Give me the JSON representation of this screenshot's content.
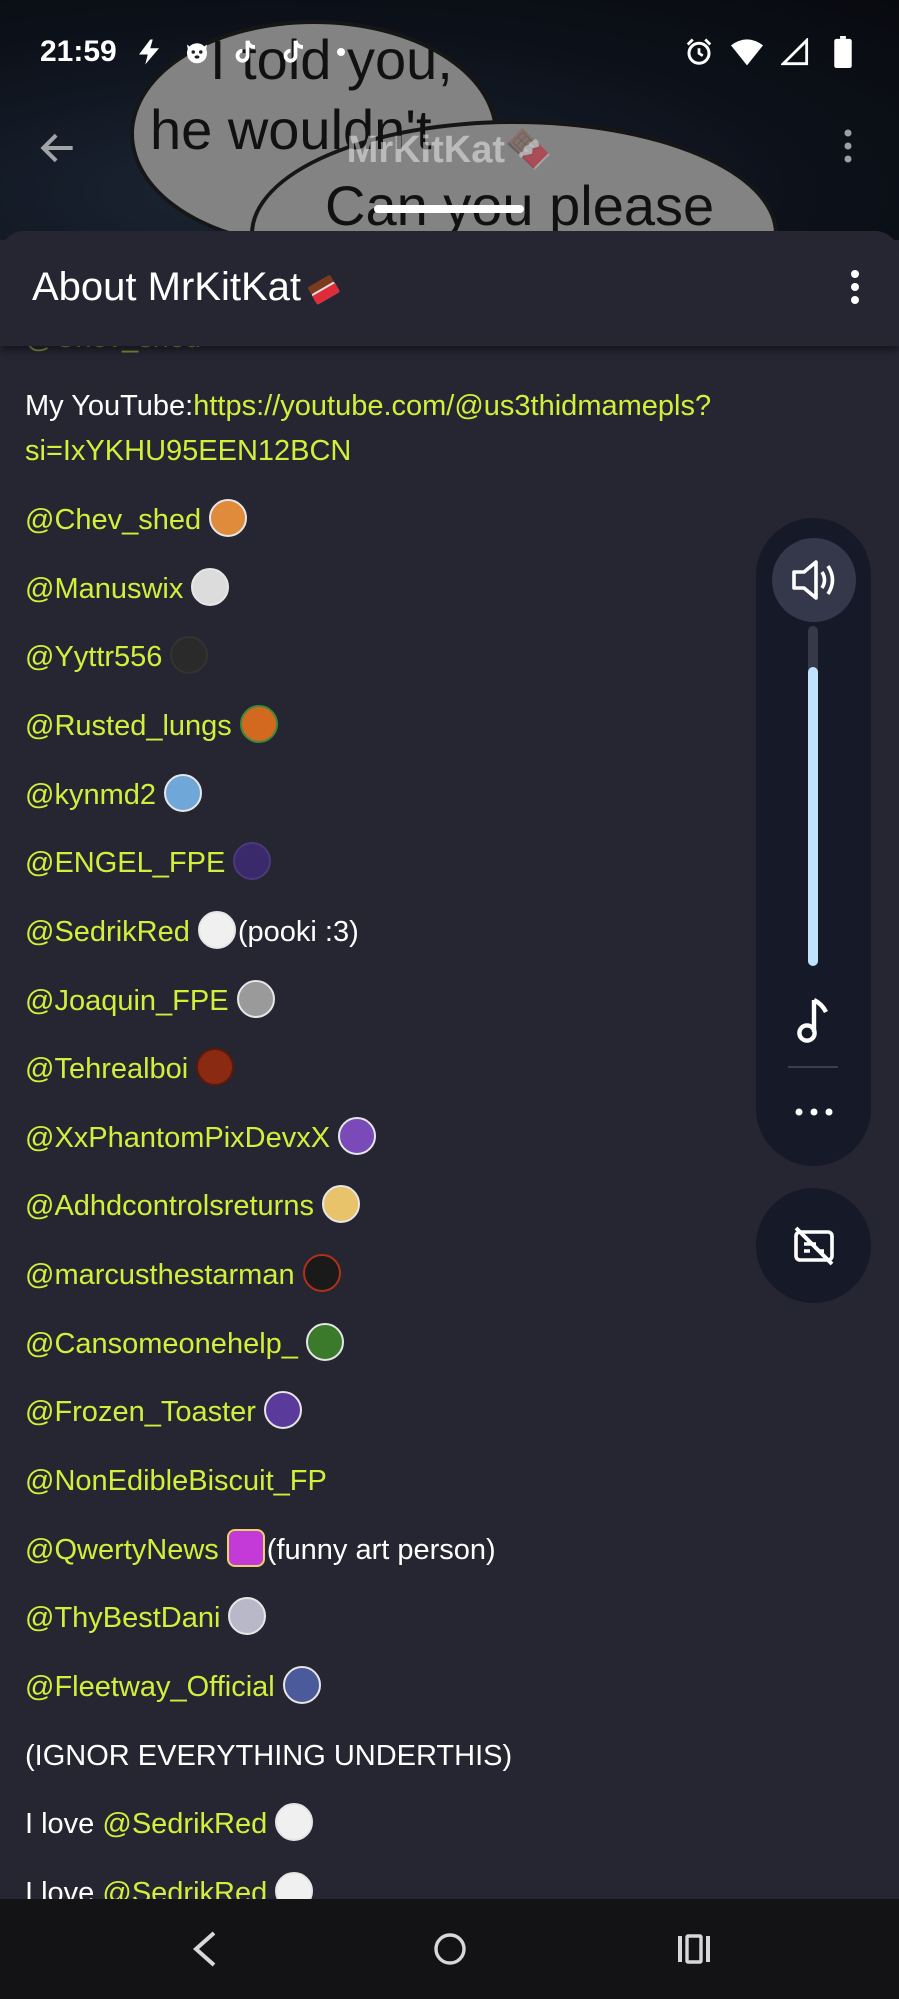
{
  "status_bar": {
    "time": "21:59",
    "left_icons": [
      "lightning-icon",
      "dog-face-icon",
      "tiktok-icon",
      "tiktok-icon",
      "notification-dot-icon"
    ],
    "right_icons": [
      "alarm-icon",
      "wifi-icon",
      "cell-signal-icon",
      "battery-icon"
    ]
  },
  "banner": {
    "bubble_lines": [
      "I told you,",
      "he wouldn't",
      "Can you please"
    ]
  },
  "app_bar": {
    "title": "MrKitKat🍫"
  },
  "sheet": {
    "title": "About MrKitKat",
    "title_emoji": "chocolate-bar-icon"
  },
  "about": {
    "youtube_label": "My YouTube:",
    "youtube_link_1": "https://youtube.com/@us3thidmamepls?",
    "youtube_link_2": "si=IxYKHU95EEN12BCN",
    "mentions": [
      {
        "handle": "@Chev_shed",
        "note": ""
      },
      {
        "handle": "@Manuswix",
        "note": ""
      },
      {
        "handle": "@Yyttr556",
        "note": ""
      },
      {
        "handle": "@Rusted_lungs",
        "note": ""
      },
      {
        "handle": "@kynmd2",
        "note": ""
      },
      {
        "handle": "@ENGEL_FPE",
        "note": ""
      },
      {
        "handle": "@SedrikRed",
        "note": "(pooki :3)"
      },
      {
        "handle": "@Joaquin_FPE",
        "note": ""
      },
      {
        "handle": "@Tehrealboi",
        "note": ""
      },
      {
        "handle": "@XxPhantomPixDevxX",
        "note": ""
      },
      {
        "handle": "@Adhdcontrolsreturns",
        "note": ""
      },
      {
        "handle": "@marcusthestarman",
        "note": ""
      },
      {
        "handle": "@Cansomeonehelp_",
        "note": ""
      },
      {
        "handle": "@Frozen_Toaster",
        "note": ""
      },
      {
        "handle": "@NonEdibleBiscuit_FP",
        "note": ""
      },
      {
        "handle": "@QwertyNews",
        "note": "(funny art person)"
      },
      {
        "handle": "@ThyBestDani",
        "note": ""
      },
      {
        "handle": "@Fleetway_Official",
        "note": ""
      }
    ],
    "ignore_line": "(IGNOR EVERYTHING UNDERTHIS)",
    "love_prefix": "I love ",
    "love_handle": "@SedrikRed"
  },
  "volume_panel": {
    "level_percent": 88,
    "icons": [
      "speaker-icon",
      "music-note-icon",
      "more-dots-icon"
    ],
    "caption_icon": "captions-off-icon"
  },
  "nav_bar": {
    "icons": [
      "back-icon",
      "home-icon",
      "recents-icon"
    ]
  },
  "colors": {
    "background": "#262532",
    "link": "#d2ef3a",
    "panel": "#161a28",
    "volume_fill": "#bfe3ff"
  }
}
